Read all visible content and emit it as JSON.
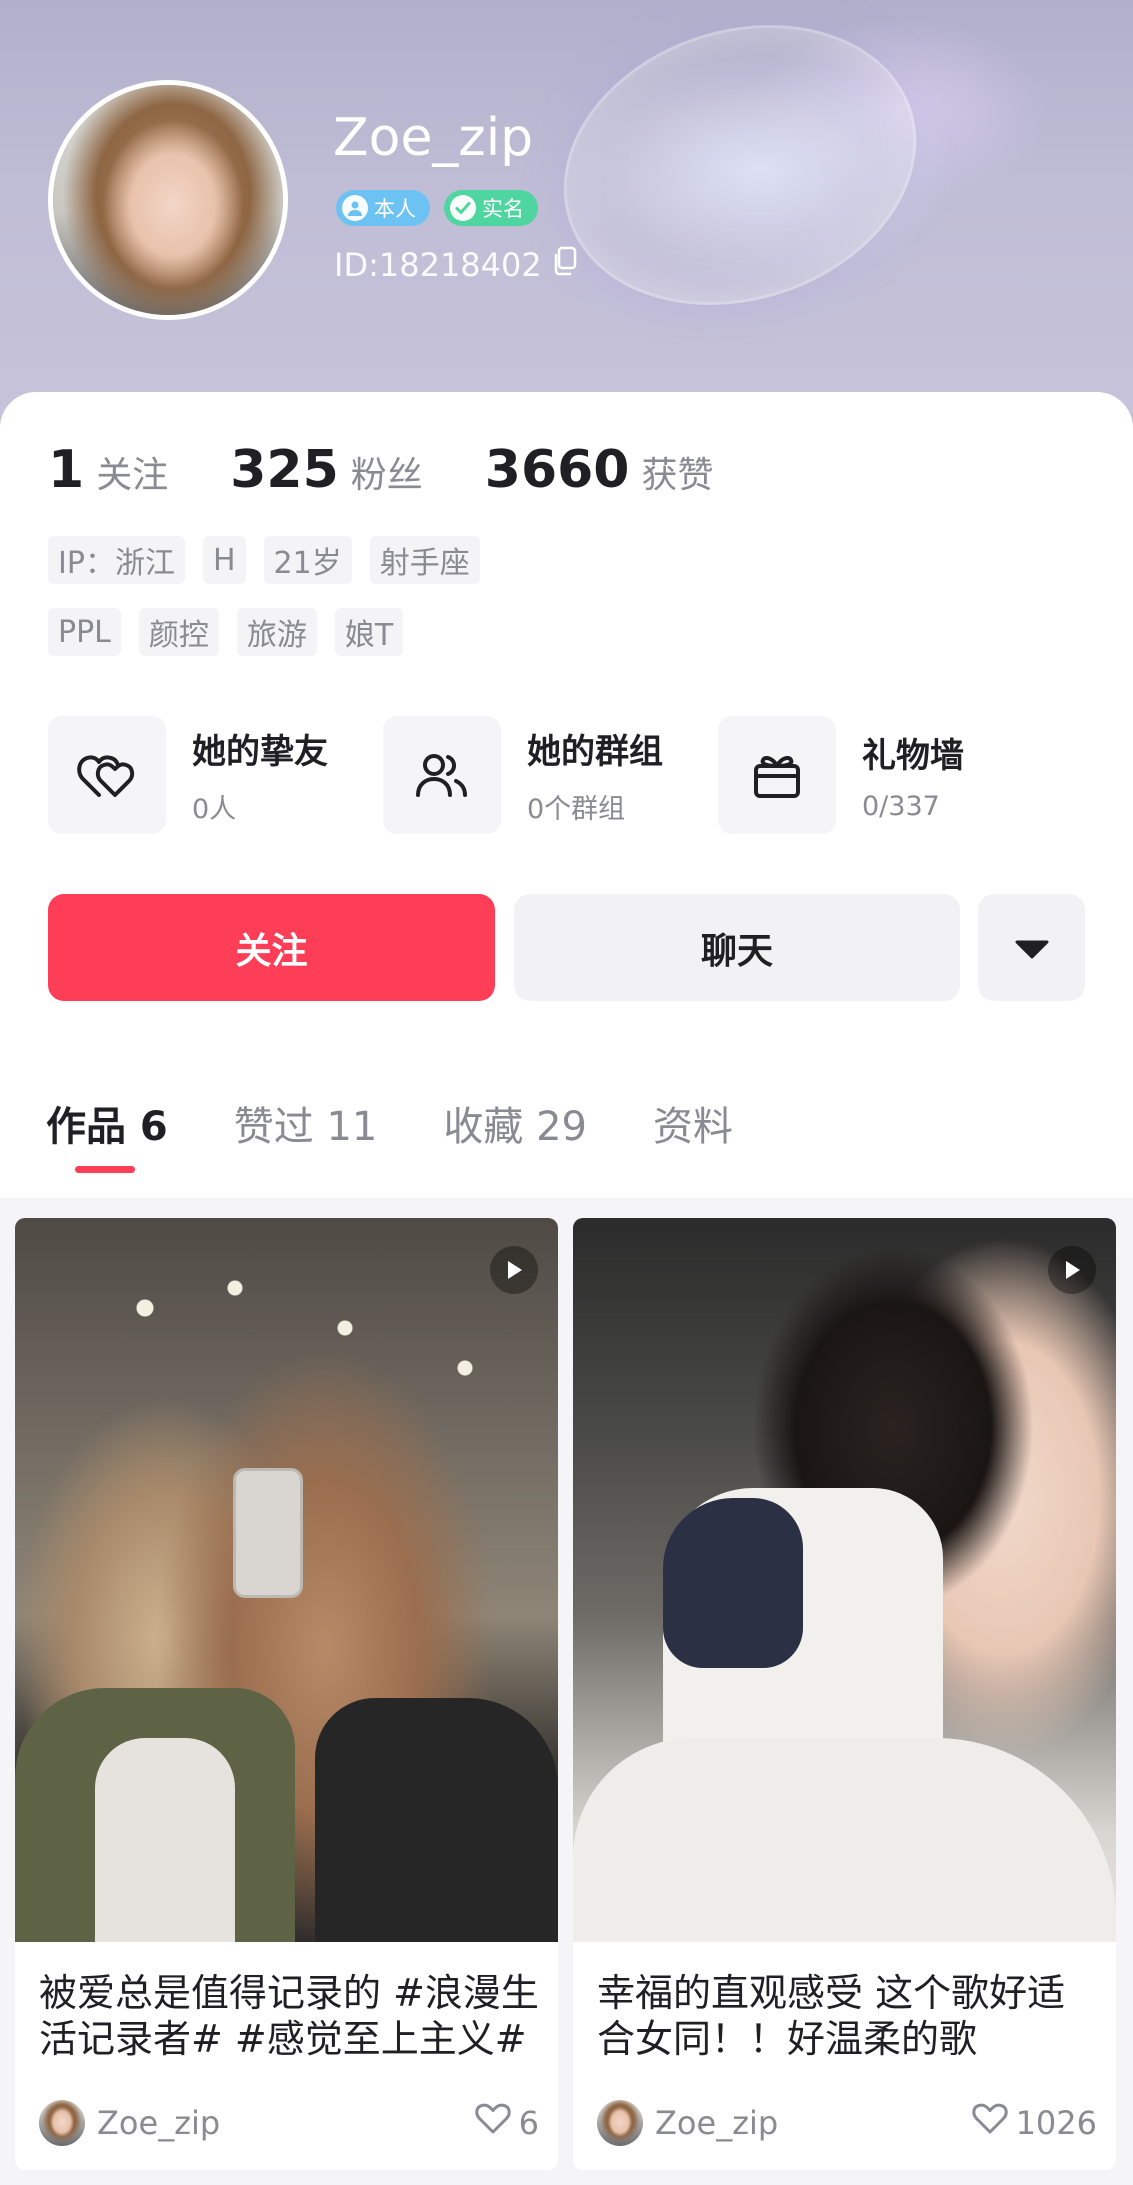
{
  "profile": {
    "name": "Zoe_zip",
    "badges": [
      {
        "label": "本人",
        "color": "#6cc2f3"
      },
      {
        "label": "实名",
        "color": "#4fd6a0"
      }
    ],
    "id_text": "ID:18218402"
  },
  "stats": [
    {
      "value": "1",
      "label": "关注"
    },
    {
      "value": "325",
      "label": "粉丝"
    },
    {
      "value": "3660",
      "label": "获赞"
    }
  ],
  "tags": {
    "row1": [
      "IP：浙江",
      "H",
      "21岁",
      "射手座"
    ],
    "row2": [
      "PPL",
      "颜控",
      "旅游",
      "娘T"
    ]
  },
  "quick_links": [
    {
      "title": "她的挚友",
      "sub": "0人",
      "icon": "heart-pair-icon"
    },
    {
      "title": "她的群组",
      "sub": "0个群组",
      "icon": "group-icon"
    },
    {
      "title": "礼物墙",
      "sub": "0/337",
      "icon": "gift-icon"
    }
  ],
  "actions": {
    "follow": "关注",
    "chat": "聊天",
    "more_icon": "caret-down-icon"
  },
  "tabs": [
    {
      "label": "作品 6",
      "active": true
    },
    {
      "label": "赞过 11",
      "active": false
    },
    {
      "label": "收藏 29",
      "active": false
    },
    {
      "label": "资料",
      "active": false
    }
  ],
  "posts": [
    {
      "caption": "被爱总是值得记录的 #浪漫生活记录者# #感觉至上主义#",
      "author": "Zoe_zip",
      "likes": "6"
    },
    {
      "caption": "幸福的直观感受 这个歌好适合女同！！好温柔的歌",
      "author": "Zoe_zip",
      "likes": "1026"
    }
  ],
  "colors": {
    "accent": "#fe3d56",
    "text_primary": "#1f1f24",
    "text_secondary": "#8a8a92"
  }
}
